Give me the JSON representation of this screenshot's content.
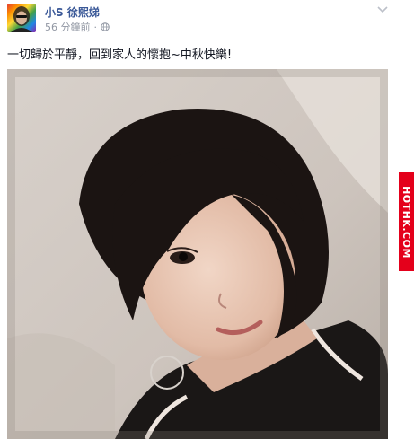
{
  "post": {
    "author": "小S 徐熙娣",
    "time": "56 分鐘前",
    "separator": "·",
    "caption": "一切歸於平靜，回到家人的懷抱~中秋快樂!",
    "icons": {
      "privacy": "globe-icon",
      "options": "chevron-down-icon",
      "avatar": "profile-photo"
    }
  },
  "watermark": {
    "text": "HOTHK.COM",
    "color": "#e4001b"
  },
  "colors": {
    "link": "#3b5998",
    "meta": "#9197a3",
    "text": "#141823"
  }
}
